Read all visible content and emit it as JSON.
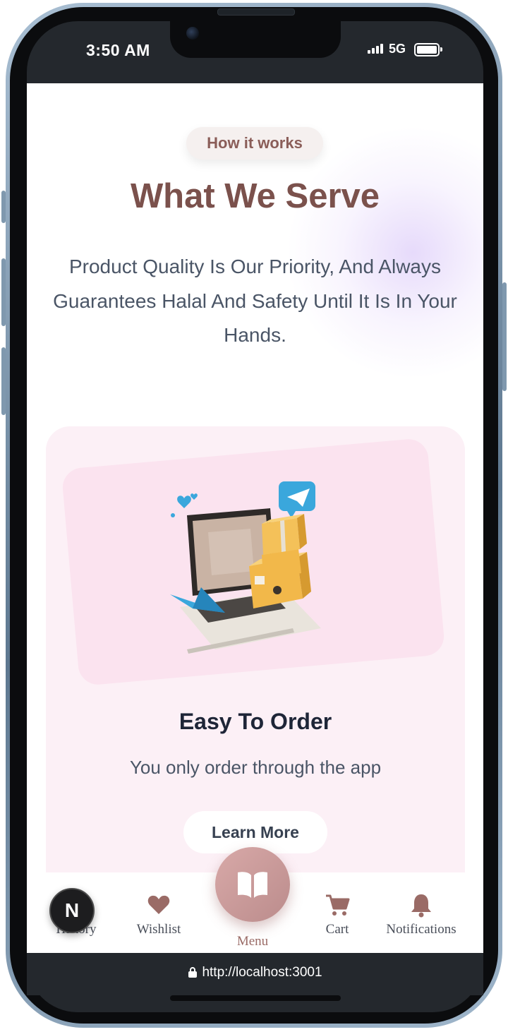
{
  "status_bar": {
    "time": "3:50 AM",
    "network": "5G"
  },
  "section": {
    "badge": "How it works",
    "title": "What We Serve",
    "subtitle": "Product Quality Is Our Priority, And Always Guarantees Halal And Safety Until It Is In Your Hands."
  },
  "card": {
    "title": "Easy To Order",
    "description": "You only order through the app",
    "button_label": "Learn More"
  },
  "bottom_nav": {
    "items": [
      {
        "label": "History",
        "icon": "history-icon"
      },
      {
        "label": "Wishlist",
        "icon": "heart-icon"
      },
      {
        "label": "Menu",
        "icon": "book-icon"
      },
      {
        "label": "Cart",
        "icon": "cart-icon"
      },
      {
        "label": "Notifications",
        "icon": "bell-icon"
      }
    ]
  },
  "dev_badge": {
    "letter": "N"
  },
  "browser": {
    "url": "http://localhost:3001"
  },
  "colors": {
    "accent": "#7b514c",
    "nav_icon": "#9a6b66",
    "card_bg": "#fcf0f6"
  }
}
